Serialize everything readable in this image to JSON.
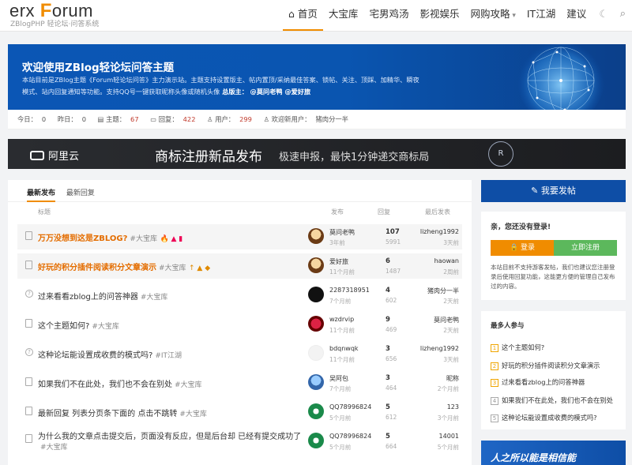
{
  "logo": {
    "main_pre": "erx ",
    "main_f": "F",
    "main_post": "orum",
    "sub": "ZBlogPHP 轻论坛·问答系统"
  },
  "nav": {
    "items": [
      "⌂ 首页",
      "大宝库",
      "宅男鸡汤",
      "影视娱乐",
      "网购攻略",
      "IT江湖",
      "建议"
    ]
  },
  "banner": {
    "title": "欢迎使用ZBlog轻论坛问答主题",
    "desc_1": "本站目前是ZBlog主题《Forum轻论坛问答》主力演示站。主题支持设置版主、帖内置顶/采纳最佳答案、锁帖、关注、顶踩、加精华、瞬夜",
    "desc_2": "模式、站内回复通知等功能。支持QQ号一键获取昵称头像或随机头像",
    "desc_3": " 总版主：",
    "desc_4": "@莫问老鸭 @爱好旅"
  },
  "stats": {
    "today_label": "今日：",
    "today": "0",
    "yest_label": "昨日：",
    "yest": "0",
    "topics_label": "主题：",
    "topics": "67",
    "replies_label": "回复：",
    "replies": "422",
    "users_label": "用户：",
    "users": "299",
    "welcome_label": "欢迎新用户：",
    "welcome_user": "猪肉分一半"
  },
  "ad": {
    "brand": "阿里云",
    "title": "商标注册新品发布",
    "sub": "极速申报，最快1分钟递交商标局",
    "deco": "R"
  },
  "tabs": [
    "最新发布",
    "最新回复"
  ],
  "head": {
    "title": "标题",
    "post": "发布",
    "reply": "回复",
    "last": "最后发表"
  },
  "rows": [
    {
      "title": "万万没想到这是ZBLOG?",
      "tag": "#大宝库",
      "flags": "🔥 ▲ ▮",
      "user": "莫问老鸭",
      "udate": "3年前",
      "rep": "107",
      "view": "5991",
      "last": "lizheng1992",
      "ltime": "3天前"
    },
    {
      "title": "好玩的积分插件阅读积分文章演示",
      "tag": "#大宝库",
      "flags": "↑ ▲ ◆",
      "user": "爱好旅",
      "udate": "11个月前",
      "rep": "6",
      "view": "1487",
      "last": "haowan",
      "ltime": "2周前"
    },
    {
      "title": "过来看看zblog上的问答神器",
      "tag": "#大宝库",
      "flags": "",
      "user": "2287318951",
      "udate": "7个月前",
      "rep": "4",
      "view": "602",
      "last": "猪肉分一半",
      "ltime": "2天前"
    },
    {
      "title": "这个主题如何?",
      "tag": "#大宝库",
      "flags": "",
      "user": "wzdrvip",
      "udate": "11个月前",
      "rep": "9",
      "view": "469",
      "last": "莫问老鸭",
      "ltime": "2天前"
    },
    {
      "title": "这种论坛能设置成收费的模式吗?",
      "tag": "#IT江湖",
      "flags": "",
      "user": "bdqnwqk",
      "udate": "11个月前",
      "rep": "3",
      "view": "656",
      "last": "lizheng1992",
      "ltime": "3天前"
    },
    {
      "title": "如果我们不在此处，我们也不会在别处",
      "tag": "#大宝库",
      "flags": "",
      "user": "吴阿包",
      "udate": "7个月前",
      "rep": "3",
      "view": "464",
      "last": "昵称",
      "ltime": "2个月前"
    },
    {
      "title": "最新回复 列表分页条下面的 点击不跳转",
      "tag": "#大宝库",
      "flags": "",
      "user": "QQ78996824",
      "udate": "5个月前",
      "rep": "5",
      "view": "612",
      "last": "123",
      "ltime": "3个月前"
    },
    {
      "title": "为什么我的文章点击提交后，页面没有反应，但是后台却 已经有提交成功了",
      "tag": "#大宝库",
      "flags": "",
      "user": "QQ78996824",
      "udate": "5个月前",
      "rep": "5",
      "view": "664",
      "last": "14001",
      "ltime": "5个月前"
    }
  ],
  "sidebar": {
    "post_btn": "✎ 我要发帖",
    "hello": "亲，您还没有登录!",
    "login": "🔒 登录",
    "register": "立即注册",
    "note": "本站目前不支持游客发帖，我们也建议您注册登录后使用回复功能，这能更方便的管理自己发布过的内容。",
    "hot_title": "最多人参与",
    "hot": [
      "这个主题如何?",
      "好玩的积分插件阅读积分文章演示",
      "过来看看zblog上的问答神器",
      "如果我们不在此处，我们也不会在别处",
      "这种论坛能设置成收费的模式吗?"
    ],
    "hot_nums": [
      "1",
      "2",
      "3",
      "4",
      "5"
    ],
    "ad_text": "人之所以能是相信能"
  },
  "colors": {
    "accent": "#f08c00",
    "brand_blue": "#0e4ea6",
    "green": "#5cb85c",
    "red": "#c0392b"
  }
}
